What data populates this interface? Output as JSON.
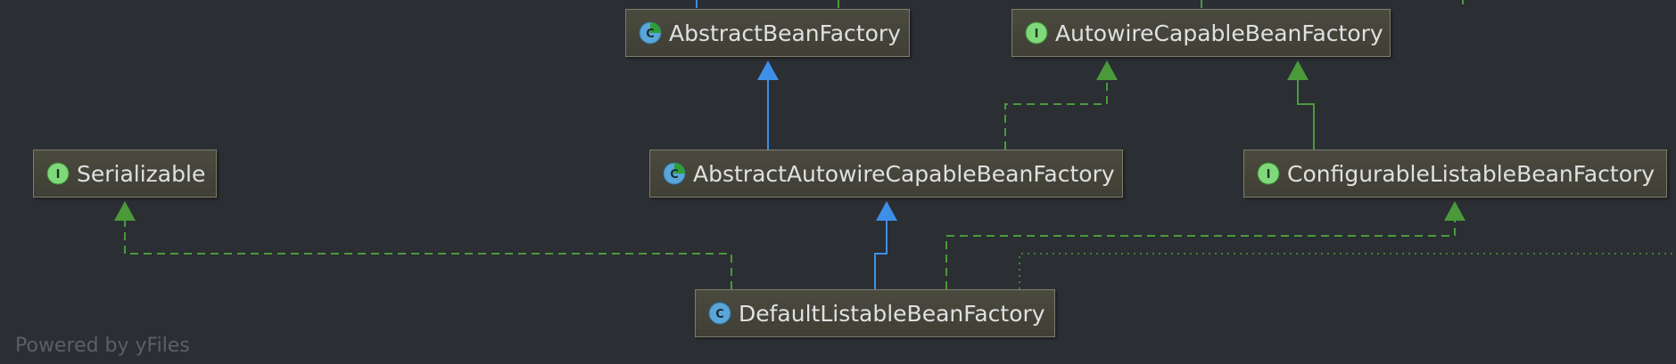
{
  "nodes": {
    "abstract_bean_factory": {
      "label": "AbstractBeanFactory",
      "kind": "abstract-class"
    },
    "autowire_capable_bean_factory": {
      "label": "AutowireCapableBeanFactory",
      "kind": "interface"
    },
    "serializable": {
      "label": "Serializable",
      "kind": "interface"
    },
    "abstract_autowire_capable_bean_factory": {
      "label": "AbstractAutowireCapableBeanFactory",
      "kind": "abstract-class"
    },
    "configurable_listable_bean_factory": {
      "label": "ConfigurableListableBeanFactory",
      "kind": "interface"
    },
    "default_listable_bean_factory": {
      "label": "DefaultListableBeanFactory",
      "kind": "class"
    }
  },
  "edges": [
    {
      "from": "abstract_autowire_capable_bean_factory",
      "to": "abstract_bean_factory",
      "type": "extends"
    },
    {
      "from": "abstract_autowire_capable_bean_factory",
      "to": "autowire_capable_bean_factory",
      "type": "implements"
    },
    {
      "from": "configurable_listable_bean_factory",
      "to": "autowire_capable_bean_factory",
      "type": "extends-interface"
    },
    {
      "from": "default_listable_bean_factory",
      "to": "abstract_autowire_capable_bean_factory",
      "type": "extends"
    },
    {
      "from": "default_listable_bean_factory",
      "to": "serializable",
      "type": "implements"
    },
    {
      "from": "default_listable_bean_factory",
      "to": "configurable_listable_bean_factory",
      "type": "implements"
    }
  ],
  "colors": {
    "background": "#2b2e33",
    "extends_edge": "#3d8fe8",
    "implements_edge": "#4a9a3c",
    "node_border": "#7e7c6c",
    "node_text": "#e0e0e0"
  },
  "icons": {
    "class": "class-icon",
    "abstract_class": "abstract-class-icon",
    "interface": "interface-icon"
  },
  "watermark": "Powered by yFiles"
}
